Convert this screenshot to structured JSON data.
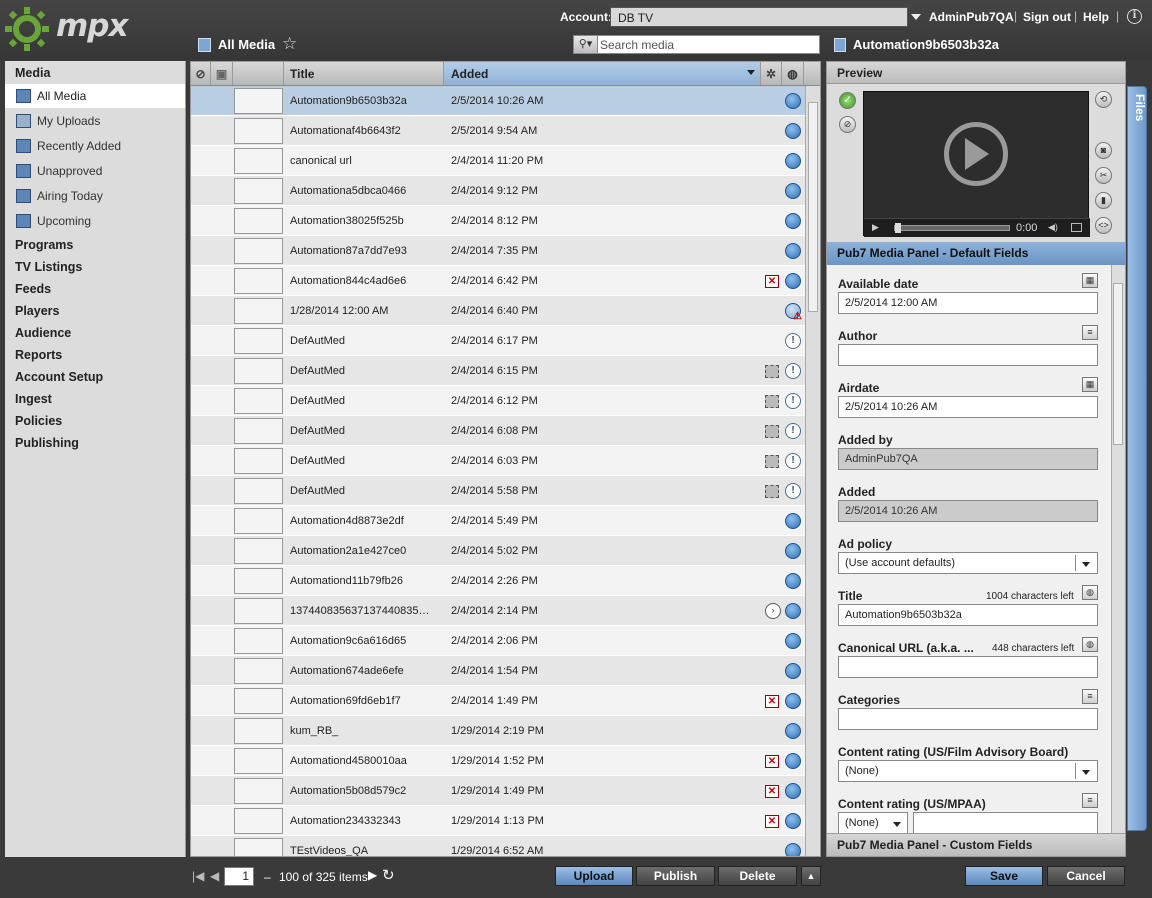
{
  "header": {
    "logo_text": "mpx",
    "account_label": "Account:",
    "account_value": "DB TV",
    "user": "AdminPub7QA",
    "sign_out": "Sign out",
    "help": "Help",
    "sep": "|"
  },
  "list": {
    "title": "All Media",
    "search_placeholder": "Search media",
    "columns": {
      "title": "Title",
      "added": "Added"
    }
  },
  "nav": {
    "groups": [
      "Media",
      "Programs",
      "TV Listings",
      "Feeds",
      "Players",
      "Audience",
      "Reports",
      "Account Setup",
      "Ingest",
      "Policies",
      "Publishing"
    ],
    "media_items": [
      "All Media",
      "My Uploads",
      "Recently Added",
      "Unapproved",
      "Airing Today",
      "Upcoming"
    ]
  },
  "rows": [
    {
      "title": "Automation9b6503b32a",
      "added": "2/5/2014 10:26 AM",
      "status": "globe"
    },
    {
      "title": "Automationaf4b6643f2",
      "added": "2/5/2014 9:54 AM",
      "status": "globe"
    },
    {
      "title": "canonical url",
      "added": "2/4/2014 11:20 PM",
      "status": "globe"
    },
    {
      "title": "Automationa5dbca0466",
      "added": "2/4/2014 9:12 PM",
      "status": "globe"
    },
    {
      "title": "Automation38025f525b",
      "added": "2/4/2014 8:12 PM",
      "status": "globe"
    },
    {
      "title": "Automation87a7dd7e93",
      "added": "2/4/2014 7:35 PM",
      "status": "globe"
    },
    {
      "title": "Automation844c4ad6e6",
      "added": "2/4/2014 6:42 PM",
      "status": "globe-x"
    },
    {
      "title": "1/28/2014 12:00 AM",
      "added": "2/4/2014 6:40 PM",
      "status": "globe-warn"
    },
    {
      "title": "DefAutMed",
      "added": "2/4/2014 6:17 PM",
      "status": "excl"
    },
    {
      "title": "DefAutMed",
      "added": "2/4/2014 6:15 PM",
      "status": "excl-box"
    },
    {
      "title": "DefAutMed",
      "added": "2/4/2014 6:12 PM",
      "status": "excl-box"
    },
    {
      "title": "DefAutMed",
      "added": "2/4/2014 6:08 PM",
      "status": "excl-box"
    },
    {
      "title": "DefAutMed",
      "added": "2/4/2014 6:03 PM",
      "status": "excl-box"
    },
    {
      "title": "DefAutMed",
      "added": "2/4/2014 5:58 PM",
      "status": "excl-box"
    },
    {
      "title": "Automation4d8873e2df",
      "added": "2/4/2014 5:49 PM",
      "status": "globe"
    },
    {
      "title": "Automation2a1e427ce0",
      "added": "2/4/2014 5:02 PM",
      "status": "globe"
    },
    {
      "title": "Automationd11b79fb26",
      "added": "2/4/2014 2:26 PM",
      "status": "globe"
    },
    {
      "title": "137440835637137440835…",
      "added": "2/4/2014 2:14 PM",
      "status": "globe-ring"
    },
    {
      "title": "Automation9c6a616d65",
      "added": "2/4/2014 2:06 PM",
      "status": "globe"
    },
    {
      "title": "Automation674ade6efe",
      "added": "2/4/2014 1:54 PM",
      "status": "globe"
    },
    {
      "title": "Automation69fd6eb1f7",
      "added": "2/4/2014 1:49 PM",
      "status": "globe-x"
    },
    {
      "title": "kum_RB_",
      "added": "1/29/2014 2:19 PM",
      "status": "globe"
    },
    {
      "title": "Automationd4580010aa",
      "added": "1/29/2014 1:52 PM",
      "status": "globe-x"
    },
    {
      "title": "Automation5b08d579c2",
      "added": "1/29/2014 1:49 PM",
      "status": "globe-x"
    },
    {
      "title": "Automation234332343",
      "added": "1/29/2014 1:13 PM",
      "status": "globe-x"
    },
    {
      "title": "TEstVideos_QA",
      "added": "1/29/2014 6:52 AM",
      "status": "globe"
    }
  ],
  "pager": {
    "page": "1",
    "dash": "–",
    "info": "100 of 325 items"
  },
  "actions": {
    "upload": "Upload",
    "publish": "Publish",
    "delete": "Delete"
  },
  "detail": {
    "title": "Automation9b6503b32a",
    "preview_label": "Preview",
    "time": "0:00",
    "fields_head": "Pub7 Media Panel - Default Fields",
    "custom_head": "Pub7 Media Panel - Custom Fields",
    "files_tab": "Files",
    "save": "Save",
    "cancel": "Cancel",
    "fields": {
      "available_date_label": "Available date",
      "available_date": "2/5/2014 12:00 AM",
      "author_label": "Author",
      "author": "",
      "airdate_label": "Airdate",
      "airdate": "2/5/2014 10:26 AM",
      "added_by_label": "Added by",
      "added_by": "AdminPub7QA",
      "added_label": "Added",
      "added": "2/5/2014 10:26 AM",
      "ad_policy_label": "Ad policy",
      "ad_policy": "(Use account defaults)",
      "title_label": "Title",
      "title_count": "1004 characters left",
      "title": "Automation9b6503b32a",
      "canonical_label": "Canonical URL (a.k.a. ...",
      "canonical_count": "448 characters left",
      "canonical": "",
      "categories_label": "Categories",
      "categories": "",
      "rating_film_label": "Content rating (US/Film Advisory Board)",
      "rating_film": "(None)",
      "rating_mpaa_label": "Content rating (US/MPAA)",
      "rating_mpaa": "(None)"
    }
  },
  "colors": {
    "accent": "#8fb2d8",
    "selected_row": "#b9cde3",
    "logo_green": "#6aa53a"
  }
}
